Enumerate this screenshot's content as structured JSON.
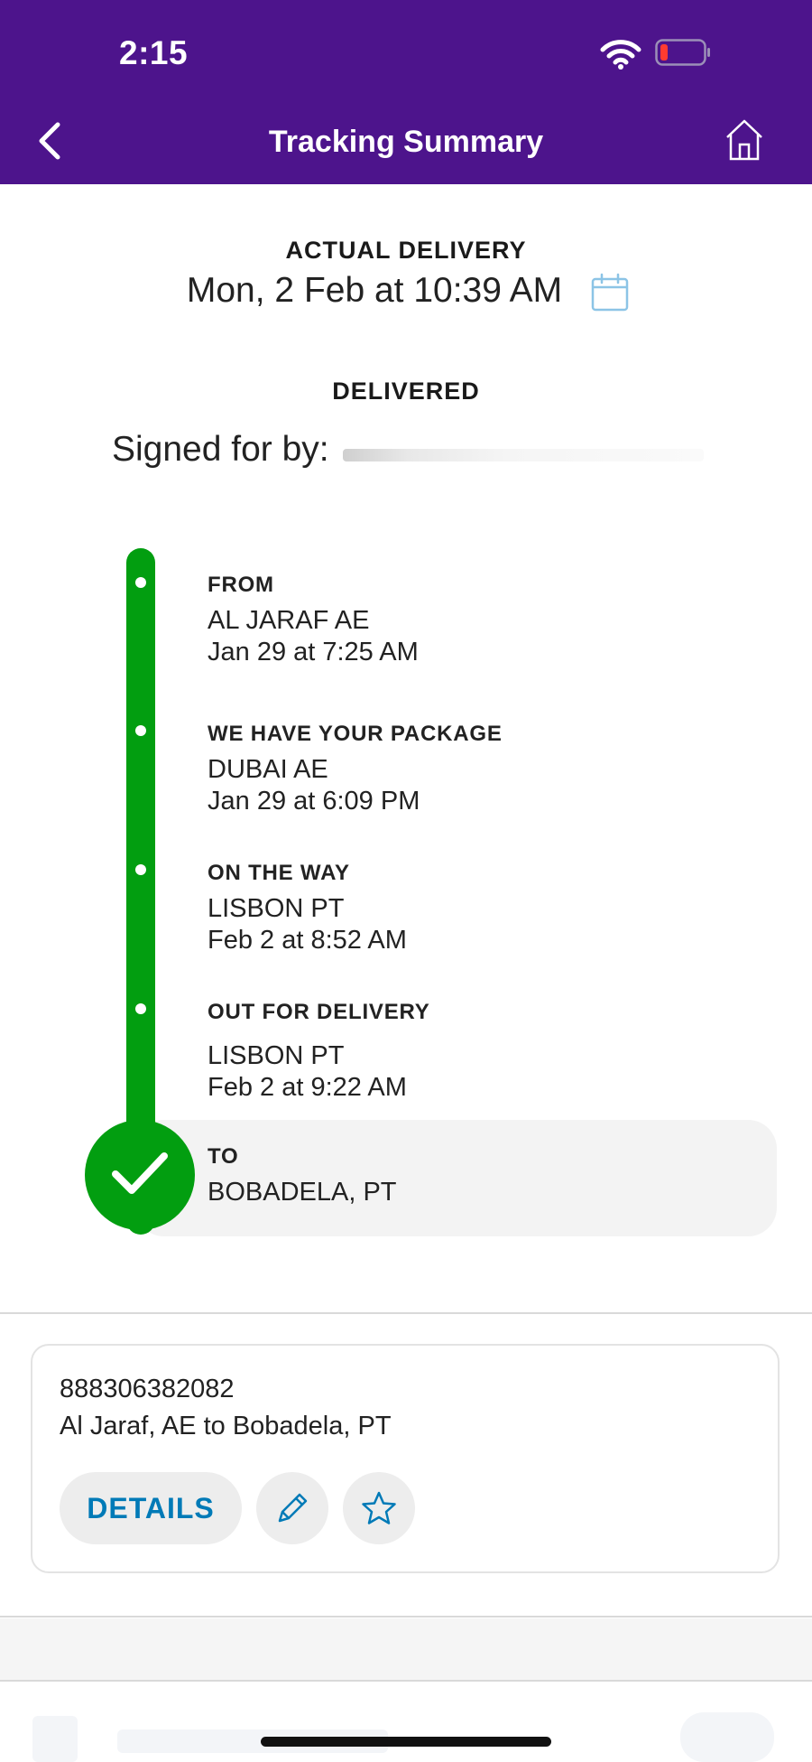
{
  "status_bar": {
    "time": "2:15"
  },
  "header": {
    "title": "Tracking Summary"
  },
  "delivery": {
    "label": "ACTUAL DELIVERY",
    "date": "Mon, 2 Feb at 10:39 AM",
    "status": "DELIVERED",
    "signed_for": "Signed for by:"
  },
  "timeline": [
    {
      "title": "FROM",
      "location": "AL JARAF AE",
      "time": "Jan 29 at 7:25 AM"
    },
    {
      "title": "WE HAVE YOUR PACKAGE",
      "location": "DUBAI AE",
      "time": "Jan 29 at 6:09 PM"
    },
    {
      "title": "ON THE WAY",
      "location": "LISBON PT",
      "time": "Feb 2 at 8:52 AM"
    },
    {
      "title": "OUT FOR DELIVERY",
      "location": "LISBON PT",
      "time": "Feb 2 at 9:22 AM"
    },
    {
      "title": "TO",
      "location": "BOBADELA, PT"
    }
  ],
  "shipment": {
    "tracking_number": "888306382082",
    "route": "Al Jaraf, AE to Bobadela, PT",
    "details_label": "DETAILS"
  },
  "colors": {
    "header": "#4d148c",
    "progress": "#029e10",
    "accent": "#007ab7"
  },
  "icons": {
    "back": "chevron-left-icon",
    "home": "home-icon",
    "calendar": "calendar-icon",
    "edit": "pencil-icon",
    "watch": "star-icon",
    "delivered": "check-icon"
  }
}
